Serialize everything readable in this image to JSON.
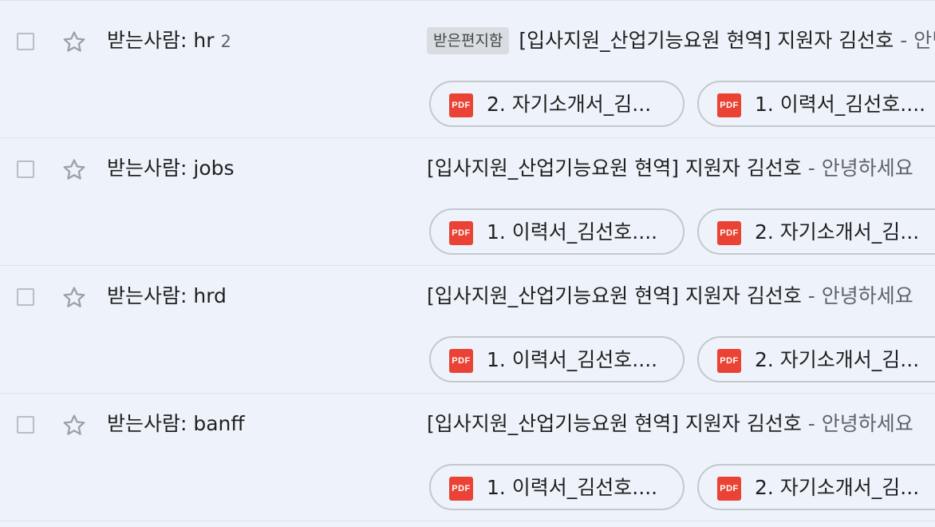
{
  "rows": [
    {
      "sender_prefix": "받는사람: hr",
      "sender_count": "2",
      "label": "받은편지함",
      "subject": "[입사지원_산업기능요원 현역] 지원자 김선호",
      "snippet": " - 안녕하세요",
      "attachments": [
        "2. 자기소개서_김...",
        "1. 이력서_김선호...."
      ]
    },
    {
      "sender_prefix": "받는사람: jobs",
      "sender_count": "",
      "label": "",
      "subject": "[입사지원_산업기능요원 현역] 지원자 김선호",
      "snippet": " - 안녕하세요",
      "attachments": [
        "1. 이력서_김선호....",
        "2. 자기소개서_김..."
      ]
    },
    {
      "sender_prefix": "받는사람: hrd",
      "sender_count": "",
      "label": "",
      "subject": "[입사지원_산업기능요원 현역] 지원자 김선호",
      "snippet": " - 안녕하세요",
      "attachments": [
        "1. 이력서_김선호....",
        "2. 자기소개서_김..."
      ]
    },
    {
      "sender_prefix": "받는사람: banff",
      "sender_count": "",
      "label": "",
      "subject": "[입사지원_산업기능요원 현역] 지원자 김선호",
      "snippet": " - 안녕하세요",
      "attachments": [
        "1. 이력서_김선호....",
        "2. 자기소개서_김..."
      ]
    }
  ],
  "pdf_icon_text": "PDF",
  "icons": {
    "checkbox": "checkbox-icon",
    "star": "star-outline-icon",
    "attachment": "pdf-icon"
  },
  "colors": {
    "background": "#eef3fb",
    "pdf_red": "#ea4335",
    "divider": "#dde3ea"
  }
}
